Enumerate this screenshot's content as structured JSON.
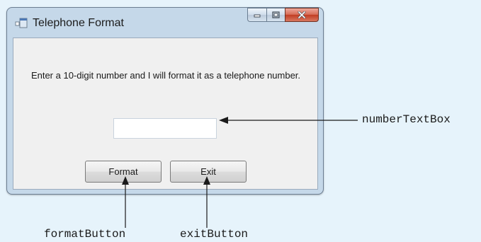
{
  "window": {
    "title": "Telephone Format",
    "prompt": "Enter a 10-digit number and I will format it as a telephone number.",
    "number_value": "",
    "buttons": {
      "format_label": "Format",
      "exit_label": "Exit"
    },
    "caption_icons": [
      "minimize-icon",
      "maximize-icon",
      "close-icon"
    ]
  },
  "callouts": {
    "number_textbox": "numberTextBox",
    "format_button": "formatButton",
    "exit_button": "exitButton"
  },
  "colors": {
    "background": "#e6f3fb",
    "window_frame": "#c5d8e9",
    "close_button": "#c13c22"
  }
}
